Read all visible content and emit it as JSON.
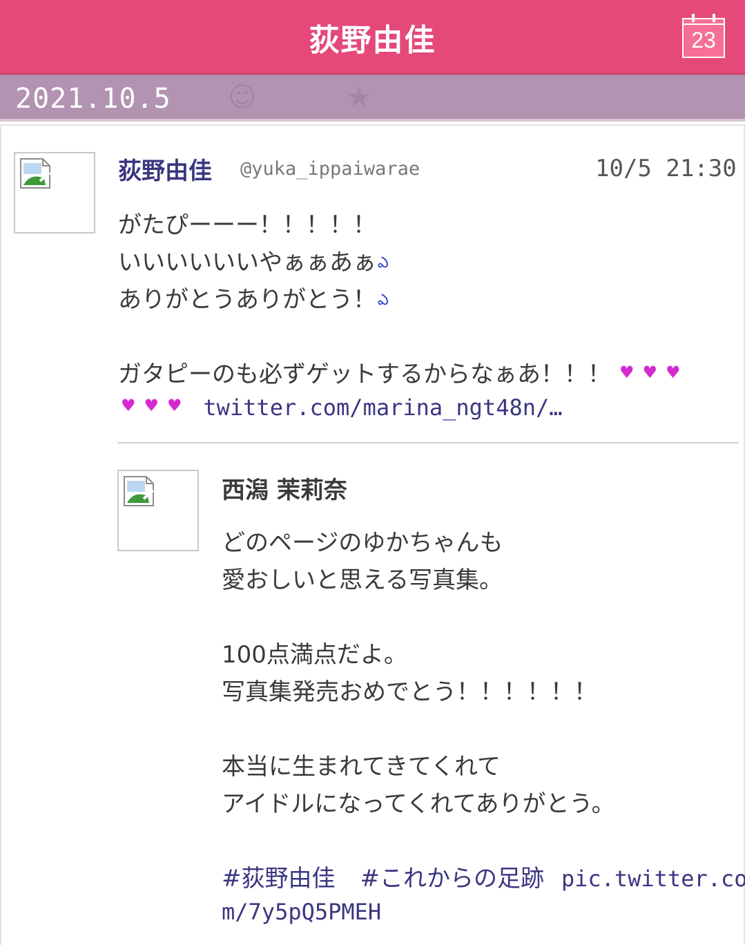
{
  "header": {
    "title": "荻野由佳",
    "calendar_day": "23"
  },
  "datebar": {
    "date": "2021.10.5"
  },
  "tweet": {
    "author_name": "荻野由佳",
    "handle": "@yuka_ippaiwarae",
    "timestamp": "10/5 21:30",
    "line1": "がたぴーーー！！！！！",
    "line2": "いいいいいいやぁぁあぁ",
    "line3": "ありがとうありがとう！",
    "line4": "ガタピーのも必ずゲットするからなぁあ！！！",
    "link": "twitter.com/marina_ngt48n/…"
  },
  "quoted": {
    "author_name": "西潟 茉莉奈",
    "line1": "どのページのゆかちゃんも",
    "line2": "愛おしいと思える写真集。",
    "line3": "100点満点だよ。",
    "line4": "写真集発売おめでとう！！！！！！",
    "line5": "本当に生まれてきてくれて",
    "line6": "アイドルになってくれてありがとう。",
    "hashtag1": "#荻野由佳",
    "hashtag2": "#これからの足跡",
    "link_part1": "pic.twitter.co",
    "link_part2": "m/7y5pQ5PMEH"
  },
  "colors": {
    "header": "#e4497a",
    "datebar": "#b293b2",
    "accent_text": "#3b3680",
    "heart": "#d42ad0",
    "sweat": "#2a3dc5"
  },
  "icons": {
    "calendar": "calendar-icon",
    "broken_image": "broken-image-icon",
    "sweat": "sweat-face-icon",
    "heart": "heart-icon"
  }
}
